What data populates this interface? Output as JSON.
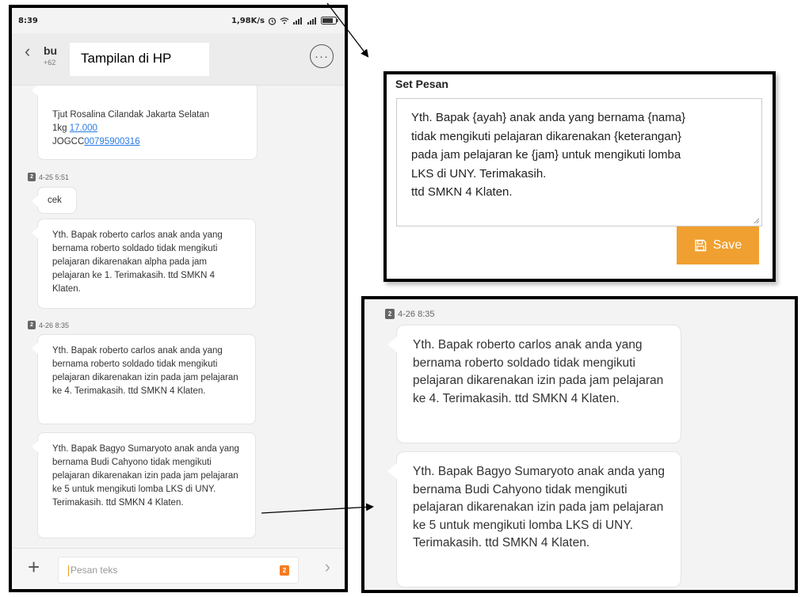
{
  "phone": {
    "status": {
      "time": "8:39",
      "speed": "1,98K/s"
    },
    "header": {
      "back_icon": "back-chevron-icon",
      "contact_name": "bu",
      "contact_number": "+62",
      "label": "Tampilan di HP",
      "more_icon": "more-options-icon"
    },
    "messages": {
      "partial_text_line1": "Tjut Rosalina Cilandak Jakarta Selatan",
      "partial_text_line2_prefix": "1kg ",
      "partial_text_line2_link": "17.000",
      "partial_text_line3_prefix": "JOGCC",
      "partial_text_line3_link": "00795900316",
      "timestamp1": "4-25 5:51",
      "sim_label": "2",
      "cek": "cek",
      "msg1": "Yth. Bapak roberto carlos anak anda yang bernama roberto soldado tidak mengikuti pelajaran dikarenakan alpha pada jam pelajaran ke 1. Terimakasih. ttd SMKN 4 Klaten.",
      "timestamp2": "4-26 8:35",
      "msg2": "Yth. Bapak roberto carlos anak anda yang bernama roberto soldado tidak mengikuti pelajaran dikarenakan izin pada jam pelajaran ke 4. Terimakasih. ttd SMKN 4 Klaten.",
      "msg3": "Yth. Bapak Bagyo Sumaryoto anak anda yang bernama Budi Cahyono tidak mengikuti pelajaran dikarenakan izin pada jam pelajaran ke 5 untuk mengikuti lomba LKS di UNY. Terimakasih. ttd SMKN 4 Klaten."
    },
    "input": {
      "placeholder": "Pesan teks",
      "sim_label": "2"
    }
  },
  "set_pesan": {
    "title": "Set Pesan",
    "line1": "Yth. Bapak {ayah} anak anda yang bernama {nama}",
    "line2": "tidak mengikuti pelajaran dikarenakan {keterangan}",
    "line3": "pada jam pelajaran ke {jam} untuk mengikuti lomba",
    "line4": "LKS di UNY. Terimakasih.",
    "line5": "ttd SMKN 4 Klaten.",
    "save_label": "Save",
    "save_color": "#f0a030"
  },
  "zoom": {
    "timestamp": "4-26 8:35",
    "sim_label": "2",
    "msg1": "Yth. Bapak roberto carlos anak anda yang bernama roberto soldado tidak mengikuti pelajaran dikarenakan izin pada jam pelajaran ke 4. Terimakasih. ttd SMKN 4 Klaten.",
    "msg2": "Yth. Bapak Bagyo Sumaryoto anak anda yang bernama Budi Cahyono tidak mengikuti pelajaran dikarenakan izin pada jam pelajaran ke 5 untuk mengikuti lomba LKS di UNY. Terimakasih. ttd SMKN 4 Klaten."
  }
}
